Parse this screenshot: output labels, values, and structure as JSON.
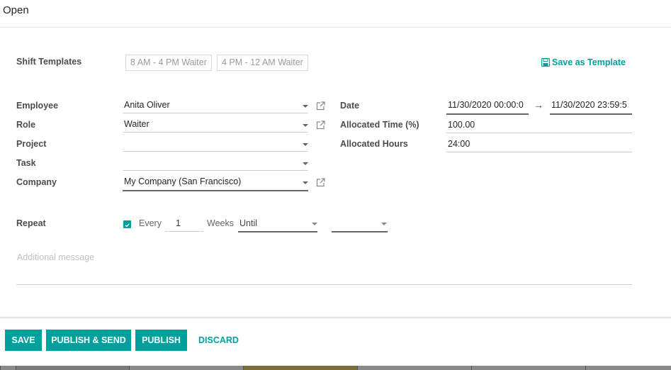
{
  "header": {
    "title": "Open"
  },
  "shift_templates": {
    "label": "Shift Templates",
    "templates": [
      "8 AM - 4 PM Waiter",
      "4 PM - 12 AM Waiter"
    ],
    "save_as_template_label": "Save as Template",
    "save_icon": "floppy-disk-icon"
  },
  "left_fields": {
    "employee": {
      "label": "Employee",
      "value": "Anita Oliver"
    },
    "role": {
      "label": "Role",
      "value": "Waiter"
    },
    "project": {
      "label": "Project",
      "value": ""
    },
    "task": {
      "label": "Task",
      "value": ""
    },
    "company": {
      "label": "Company",
      "value": "My Company (San Francisco)"
    }
  },
  "right_fields": {
    "date": {
      "label": "Date",
      "start": "11/30/2020 00:00:0",
      "end": "11/30/2020 23:59:5",
      "arrow": "→"
    },
    "allocated_time": {
      "label": "Allocated Time (%)",
      "value": "100.00"
    },
    "allocated_hours": {
      "label": "Allocated Hours",
      "value": "24:00"
    }
  },
  "repeat": {
    "label": "Repeat",
    "checked": true,
    "every_label": "Every",
    "interval": "1",
    "unit_label": "Weeks",
    "until_value": "Until",
    "until_date": ""
  },
  "message": {
    "placeholder": "Additional message"
  },
  "footer": {
    "save": "SAVE",
    "publish_send": "PUBLISH & SEND",
    "publish": "PUBLISH",
    "discard": "DISCARD"
  },
  "colors": {
    "accent": "#00A09D",
    "label": "#4c4c4c"
  }
}
